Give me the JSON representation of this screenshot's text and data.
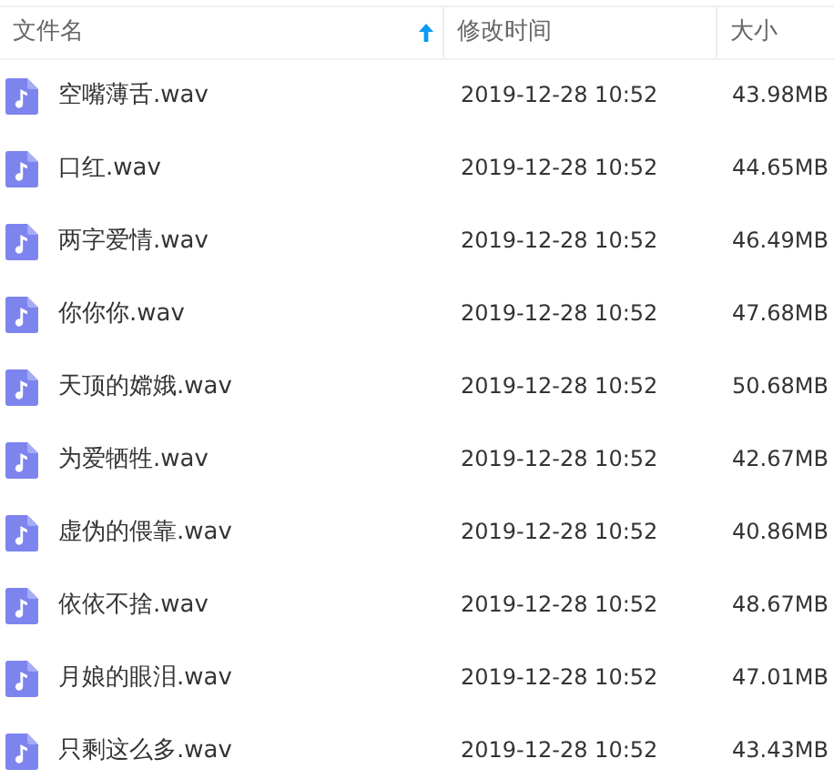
{
  "columns": [
    {
      "label": "文件名",
      "sorted": true
    },
    {
      "label": "修改时间",
      "sorted": false
    },
    {
      "label": "大小",
      "sorted": false
    }
  ],
  "files": [
    {
      "name": "空嘴薄舌.wav",
      "modified": "2019-12-28 10:52",
      "size": "43.98MB"
    },
    {
      "name": "口红.wav",
      "modified": "2019-12-28 10:52",
      "size": "44.65MB"
    },
    {
      "name": "两字爱情.wav",
      "modified": "2019-12-28 10:52",
      "size": "46.49MB"
    },
    {
      "name": "你你你.wav",
      "modified": "2019-12-28 10:52",
      "size": "47.68MB"
    },
    {
      "name": "天顶的嫦娥.wav",
      "modified": "2019-12-28 10:52",
      "size": "50.68MB"
    },
    {
      "name": "为爱牺牲.wav",
      "modified": "2019-12-28 10:52",
      "size": "42.67MB"
    },
    {
      "name": "虚伪的偎靠.wav",
      "modified": "2019-12-28 10:52",
      "size": "40.86MB"
    },
    {
      "name": "依依不捨.wav",
      "modified": "2019-12-28 10:52",
      "size": "48.67MB"
    },
    {
      "name": "月娘的眼泪.wav",
      "modified": "2019-12-28 10:52",
      "size": "47.01MB"
    },
    {
      "name": "只剩这么多.wav",
      "modified": "2019-12-28 10:52",
      "size": "43.43MB"
    }
  ]
}
